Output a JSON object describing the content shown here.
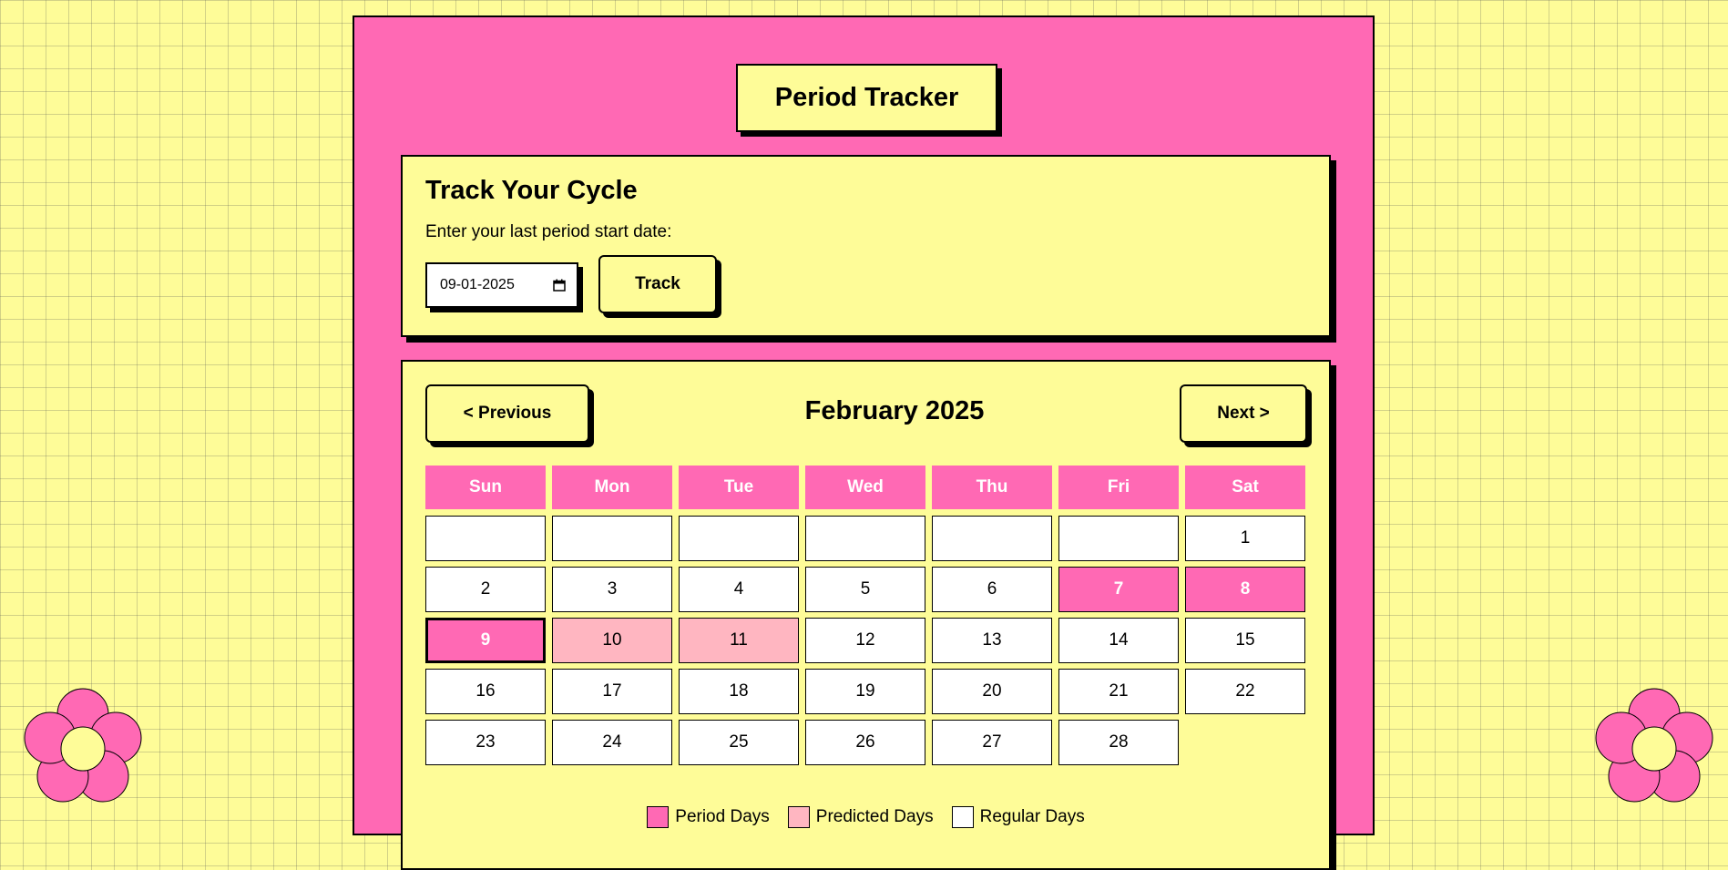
{
  "app": {
    "title": "Period Tracker"
  },
  "tracker": {
    "heading": "Track Your Cycle",
    "prompt": "Enter your last period start date:",
    "date_value": "09-01-2025",
    "track_label": "Track"
  },
  "calendar": {
    "month_title": "February 2025",
    "prev_label": "< Previous",
    "next_label": "Next >",
    "weekdays": [
      "Sun",
      "Mon",
      "Tue",
      "Wed",
      "Thu",
      "Fri",
      "Sat"
    ],
    "leading_empty_days": 6,
    "days_in_month": 28,
    "period_days": [
      7,
      8,
      9
    ],
    "predicted_days": [
      10,
      11
    ],
    "selected_day": 9
  },
  "legend": {
    "period": "Period Days",
    "predicted": "Predicted Days",
    "regular": "Regular Days"
  },
  "colors": {
    "background": "#FEFC98",
    "accent_pink": "#FF69B4",
    "predicted_pink": "#FFB6C1",
    "regular": "#FFFFFF"
  },
  "icons": {
    "date_picker": "calendar-icon",
    "decoration": "flower-icon"
  }
}
